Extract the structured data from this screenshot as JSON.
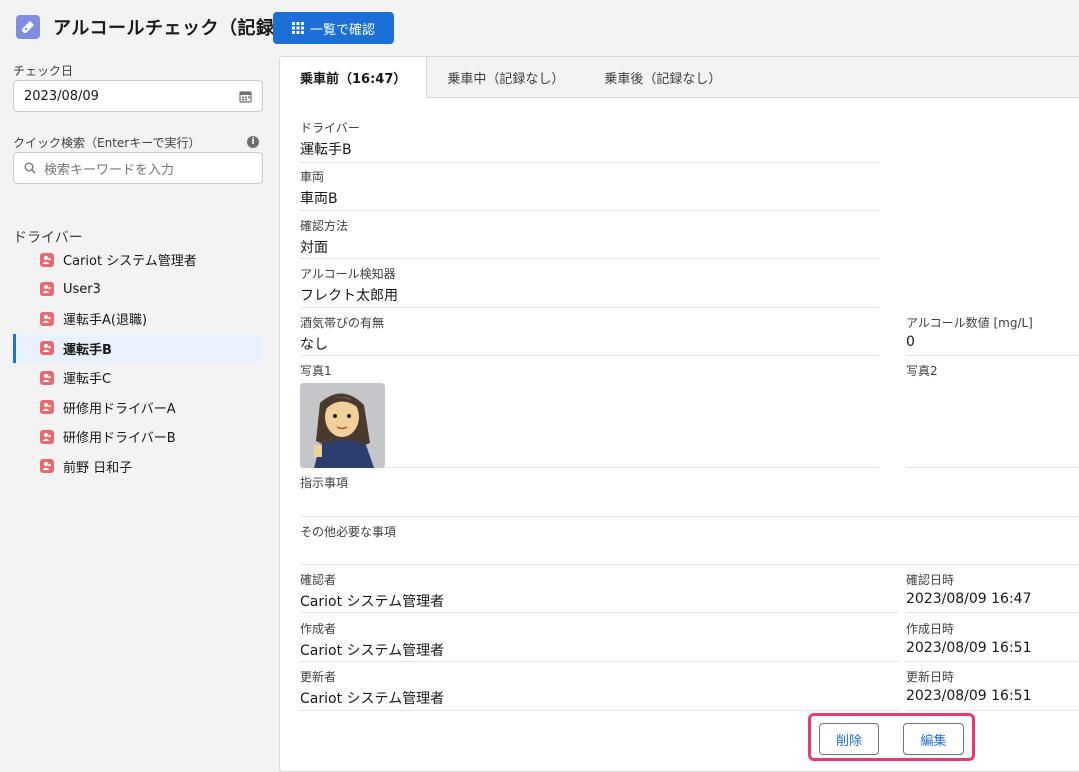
{
  "header": {
    "title": "アルコールチェック（記録）",
    "list_button": "一覧で確認",
    "accent": "#1b6fd6"
  },
  "sidebar": {
    "check_date_label": "チェック日",
    "check_date_value": "2023/08/09",
    "quick_search_label": "クイック検索（Enterキーで実行）",
    "search_placeholder": "検索キーワードを入力",
    "driver_heading": "ドライバー",
    "drivers": [
      {
        "label": "Cariot システム管理者",
        "active": false
      },
      {
        "label": "User3",
        "active": false
      },
      {
        "label": "運転手A(退職)",
        "active": false
      },
      {
        "label": "運転手B",
        "active": true
      },
      {
        "label": "運転手C",
        "active": false
      },
      {
        "label": "研修用ドライバーA",
        "active": false
      },
      {
        "label": "研修用ドライバーB",
        "active": false
      },
      {
        "label": "前野 日和子",
        "active": false
      }
    ]
  },
  "tabs": [
    {
      "label": "乗車前（16:47）",
      "active": true
    },
    {
      "label": "乗車中（記録なし）",
      "active": false
    },
    {
      "label": "乗車後（記録なし）",
      "active": false
    }
  ],
  "record": {
    "driver": {
      "label": "ドライバー",
      "value": "運転手B"
    },
    "vehicle": {
      "label": "車両",
      "value": "車両B"
    },
    "method": {
      "label": "確認方法",
      "value": "対面"
    },
    "detector": {
      "label": "アルコール検知器",
      "value": "フレクト太郎用"
    },
    "intoxicated": {
      "label": "酒気帯びの有無",
      "value": "なし"
    },
    "alcohol_value": {
      "label": "アルコール数値 [mg/L]",
      "value": "0"
    },
    "photo1": {
      "label": "写真1"
    },
    "photo2": {
      "label": "写真2"
    },
    "instructions": {
      "label": "指示事項",
      "value": ""
    },
    "other": {
      "label": "その他必要な事項",
      "value": ""
    },
    "confirmer": {
      "label": "確認者",
      "value": "Cariot システム管理者"
    },
    "confirmed_at": {
      "label": "確認日時",
      "value": "2023/08/09 16:47"
    },
    "creator": {
      "label": "作成者",
      "value": "Cariot システム管理者"
    },
    "created_at": {
      "label": "作成日時",
      "value": "2023/08/09 16:51"
    },
    "updater": {
      "label": "更新者",
      "value": "Cariot システム管理者"
    },
    "updated_at": {
      "label": "更新日時",
      "value": "2023/08/09 16:51"
    }
  },
  "actions": {
    "delete": "削除",
    "edit": "編集"
  }
}
